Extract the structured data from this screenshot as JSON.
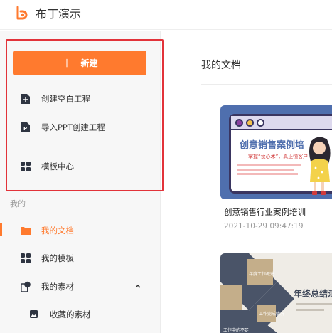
{
  "app": {
    "name": "布丁演示",
    "brand_color": "#ff7a2e"
  },
  "sidebar": {
    "new_button": {
      "icon": "plus-icon",
      "label": "新建"
    },
    "create_items": [
      {
        "icon": "plus-file-icon",
        "label": "创建空白工程"
      },
      {
        "icon": "ppt-file-icon",
        "label": "导入PPT创建工程"
      }
    ],
    "template_center": {
      "icon": "grid-icon",
      "label": "模板中心"
    },
    "section_label": "我的",
    "my_items": [
      {
        "icon": "folder-icon",
        "label": "我的文档",
        "active": true
      },
      {
        "icon": "grid-icon",
        "label": "我的模板"
      },
      {
        "icon": "material-icon",
        "label": "我的素材",
        "expanded": true
      },
      {
        "icon": "image-icon",
        "label": "收藏的素材"
      }
    ],
    "highlight_color": "#e2333a"
  },
  "main": {
    "title": "我的文档",
    "documents": [
      {
        "thumbnail_title": "创意销售案例培",
        "thumbnail_subtitle": "掌握“读心术”，真正懂客户",
        "name": "创意销售行业案例培训",
        "date": "2021-10-29 09:47:19"
      },
      {
        "thumbnail_title": "年终总结汇",
        "thumbnail_tags": [
          "年度工作概述",
          "工作完成情况",
          "工作中的不足"
        ]
      }
    ]
  }
}
